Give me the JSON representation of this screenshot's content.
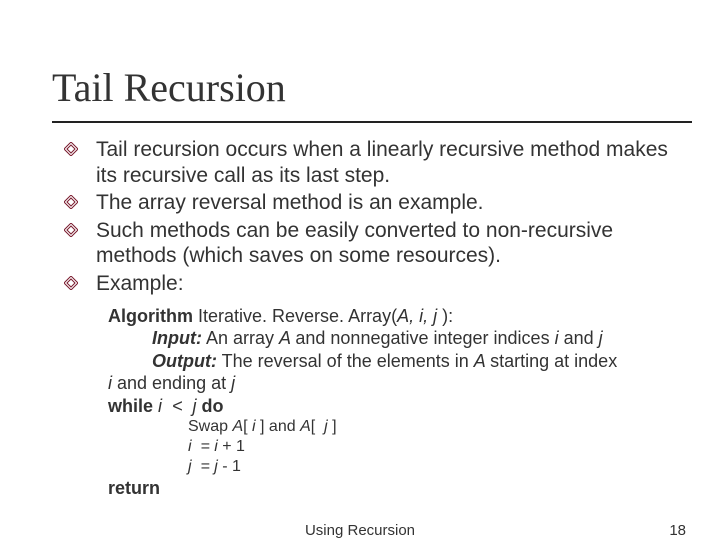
{
  "title": "Tail Recursion",
  "bullets": [
    "Tail recursion occurs when a linearly recursive method makes its recursive call as its last step.",
    "The array reversal method is an example.",
    "Such methods can be easily converted to non-recursive methods (which saves on some resources).",
    "Example:"
  ],
  "algo": {
    "kw_algorithm": "Algorithm",
    "sig_name": " Iterative. Reverse. Array(",
    "sig_params": "A, i, j ",
    "sig_close": "):",
    "kw_input": "Input:",
    "input_txt1": " An array ",
    "input_A": "A ",
    "input_txt2": "and nonnegative integer indices ",
    "input_i": "i ",
    "input_txt3": "and ",
    "input_j": "j",
    "kw_output": "Output:",
    "output_txt1": " The reversal of the elements in ",
    "output_A": "A ",
    "output_txt2": "starting at index",
    "output_line2a": "i ",
    "output_line2b": "and ending at ",
    "output_line2c": "j",
    "kw_while": "while ",
    "while_cond": "i  <  j ",
    "kw_do": "do",
    "swap_txt1": "Swap ",
    "swap_A1": "A",
    "swap_br1": "[ ",
    "swap_i": "i ",
    "swap_br2": "] and ",
    "swap_A2": "A",
    "swap_br3": "[ ",
    "swap_j": " j ",
    "swap_br4": "]",
    "inc_i": "i  = i",
    "inc_tail": " + 1",
    "dec_j": "j  = j",
    "dec_tail": " - 1",
    "kw_return": "return"
  },
  "footer": {
    "center": "Using Recursion",
    "pagenum": "18"
  }
}
